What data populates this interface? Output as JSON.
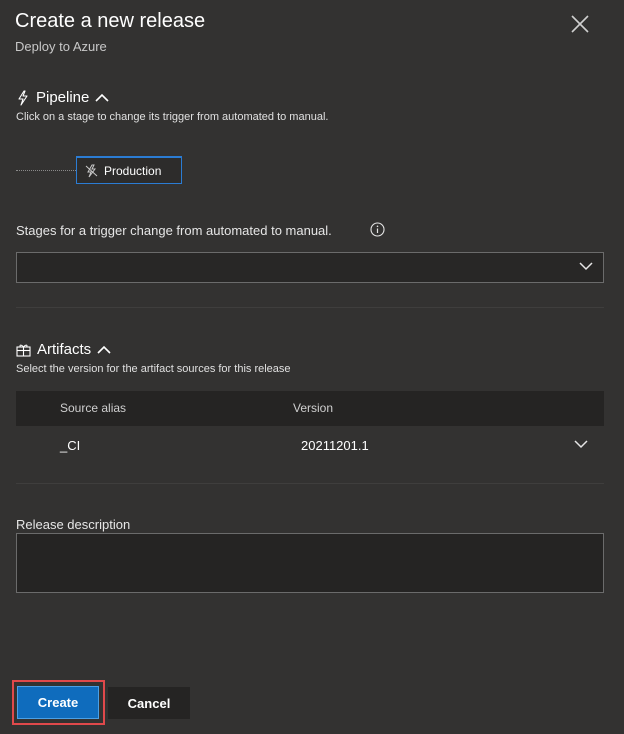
{
  "dialog": {
    "title": "Create a new release",
    "subtitle": "Deploy to Azure"
  },
  "pipeline": {
    "title": "Pipeline",
    "description": "Click on a stage to change its trigger from automated to manual.",
    "stage_name": "Production",
    "trigger_label": "Stages for a trigger change from automated to manual.",
    "trigger_value": ""
  },
  "artifacts": {
    "title": "Artifacts",
    "description": "Select the version for the artifact sources for this release",
    "columns": [
      "Source alias",
      "Version"
    ],
    "rows": [
      {
        "alias": "_CI",
        "version": "20211201.1"
      }
    ]
  },
  "release_description": {
    "label": "Release description",
    "value": ""
  },
  "buttons": {
    "create": "Create",
    "cancel": "Cancel"
  },
  "colors": {
    "background": "#333231",
    "accent": "#0f6cbd",
    "highlight_outline": "#e0494b"
  },
  "icons": [
    "close-icon",
    "lightning-icon",
    "chevron-up-icon",
    "info-icon",
    "chevron-down-icon",
    "gift-icon"
  ]
}
